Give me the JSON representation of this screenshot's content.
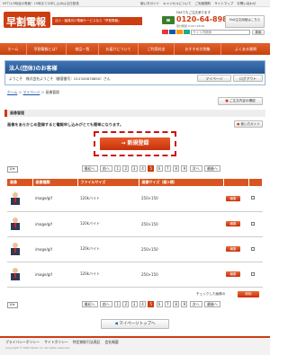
{
  "topbar": {
    "tagline": "NTT/1/3時途の電報！19時までの申し込みは当日配達",
    "links": [
      "使い方ガイド",
      "キャンセルについて",
      "ご利用規約",
      "サイトマップ",
      "お問い合わせ"
    ]
  },
  "header": {
    "logo": "早割電報",
    "subtitle": "法人・議員向け電報サービスなら『早割電報』",
    "fax_label": "FAXでもご注文承ります",
    "phone": "0120-64-8989",
    "phone_hours": "受付時間 9:00〜18:00",
    "fax_btn": "FAX注文用紙はこちら",
    "search_placeholder": "サイト内検索",
    "search_btn": "検索"
  },
  "nav": [
    "ホーム",
    "早割電報とは？",
    "商品一覧",
    "お届けについて",
    "ご利用料金",
    "おすすめ文例集",
    "よくある質問"
  ],
  "account": {
    "heading": "法人(団体)のお客様",
    "welcome": "ようこそ　株式会社ようこそ（顧客番号：012345678890）さん",
    "mypage_btn": "マイページ",
    "logout_btn": "ログアウト"
  },
  "breadcrumb": [
    "ホーム",
    "マイページ",
    "画像管理"
  ],
  "cart_btn": "ご注文内容の確認",
  "section": {
    "title": "画像管理",
    "intro": "画像をあらかじめ登録すると電報申し込みがとても簡単になります。",
    "help_btn": "使い方ガイド",
    "new_btn": "新規登録"
  },
  "pager": {
    "per_page": "10",
    "first": "最初へ",
    "prev": "前へ",
    "pages": [
      "1",
      "2",
      "3",
      "4",
      "5",
      "6",
      "7",
      "8",
      "9"
    ],
    "current": "5",
    "next": "次へ",
    "last": "最後へ"
  },
  "table": {
    "headers": [
      "画像",
      "画像種類",
      "ファイルサイズ",
      "画像サイズ（縦×横）",
      "",
      ""
    ],
    "rows": [
      {
        "type": "image/gif",
        "size": "120kバイト",
        "dims": "250×150",
        "edit": "編集"
      },
      {
        "type": "image/gif",
        "size": "120kバイト",
        "dims": "250×150",
        "edit": "編集"
      },
      {
        "type": "image/gif",
        "size": "120kバイト",
        "dims": "250×150",
        "edit": "編集"
      },
      {
        "type": "image/gif",
        "size": "120kバイト",
        "dims": "250×150",
        "edit": "編集"
      }
    ],
    "bulk_label": "チェックした画像の",
    "bulk_btn": "削除"
  },
  "back_btn": "マイページトップへ",
  "footer": {
    "links": [
      "プライバシーポリシー",
      "サイトポリシー",
      "特定商取引法表記",
      "会社概要"
    ],
    "copyright": "Copyright © 2009 Wowo co. All rights reserved."
  },
  "colors": {
    "brand": "#cc3d12",
    "nav": "#d9541e",
    "account": "#2b5f9e"
  }
}
